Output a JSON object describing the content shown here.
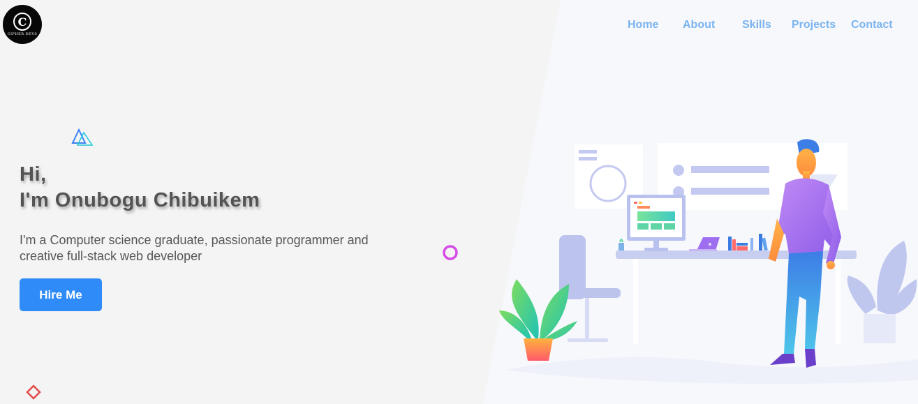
{
  "logo": {
    "letter": "C",
    "text": "CIPHER DEVS",
    "icon": "brand-logo"
  },
  "nav": {
    "items": [
      {
        "label": "Home"
      },
      {
        "label": "About"
      },
      {
        "label": "Skills"
      },
      {
        "label": "Projects"
      },
      {
        "label": "Contact"
      }
    ],
    "color": "#7ab3ef"
  },
  "hero": {
    "greeting": "Hi,",
    "name_line": "I'm Onubogu Chibuikem",
    "description_line1": "I'm a Computer science graduate, passionate programmer and",
    "description_line2": "creative full-stack web developer",
    "cta_label": "Hire Me"
  },
  "colors": {
    "accent": "#2e8bf7",
    "background_left": "#f4f4f4",
    "background_right": "#f7f8fc",
    "triangle_decoration": "#3aa6f5",
    "ring_decoration": "#d64ce6",
    "diamond_decoration": "#e24a4a"
  },
  "illustration": {
    "icon": "developer-workspace-illustration"
  }
}
